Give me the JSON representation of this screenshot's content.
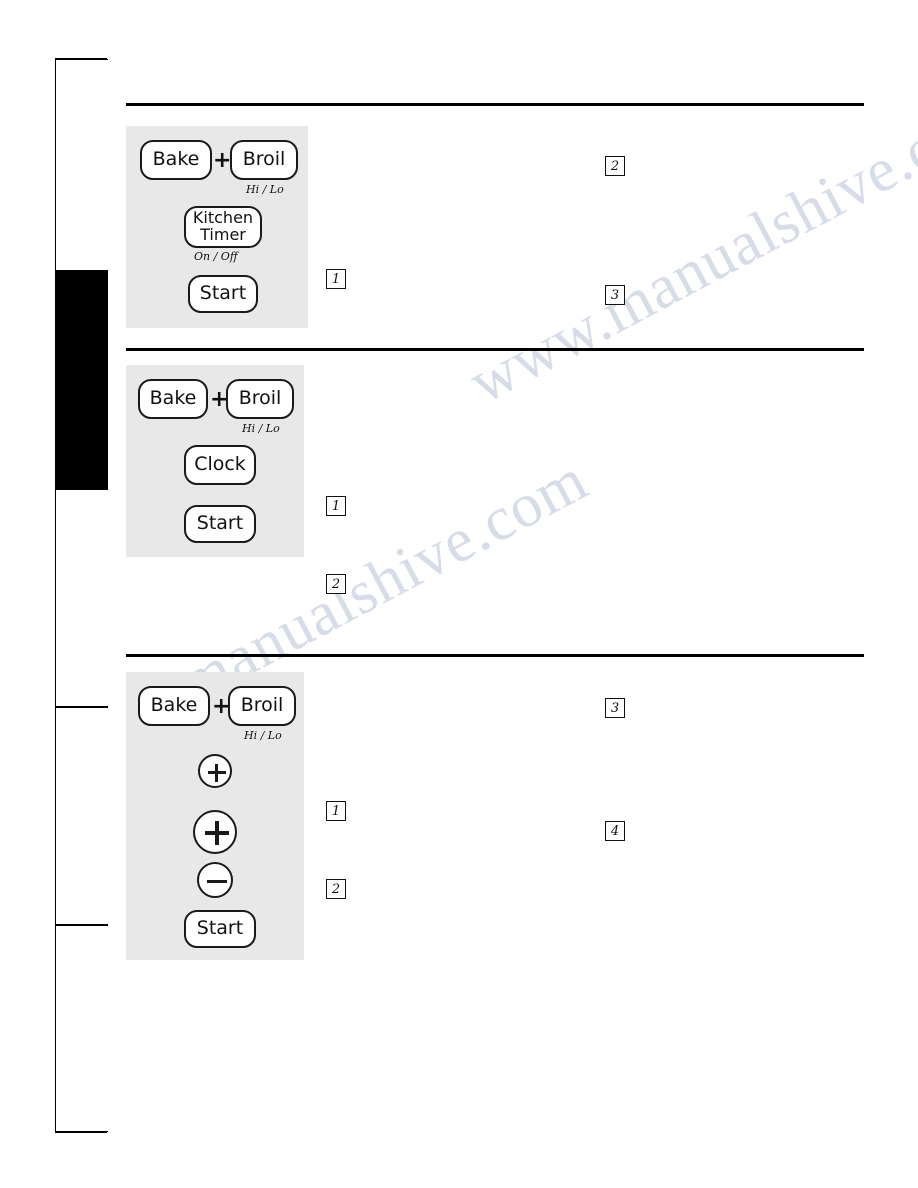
{
  "document": {
    "watermark_line1": "www.manualshive.com",
    "watermark_line2": "manualshive.com"
  },
  "tab_strip": {
    "name": "left-tab-strip",
    "segments": [
      {
        "label": "",
        "filled": false
      },
      {
        "label": "",
        "filled": true
      },
      {
        "label": "",
        "filled": false
      },
      {
        "label": "",
        "filled": false
      },
      {
        "label": "",
        "filled": false
      }
    ]
  },
  "sections": [
    {
      "id": "kitchen-timer",
      "panel": {
        "keys": [
          {
            "name": "bake-key",
            "lines": [
              "Bake"
            ]
          },
          {
            "name": "broil-key",
            "lines": [
              "Broil"
            ]
          },
          {
            "name": "kitchen-timer-key",
            "lines": [
              "Kitchen",
              "Timer"
            ]
          },
          {
            "name": "start-key",
            "lines": [
              "Start"
            ]
          }
        ],
        "plus_symbol": "+",
        "sublabels": [
          {
            "name": "broil-sublabel",
            "text": "Hi / Lo"
          },
          {
            "name": "kitchen-timer-sublabel",
            "text": "On / Off"
          }
        ]
      },
      "steps": [
        {
          "name": "step-marker-1",
          "number": "1"
        },
        {
          "name": "step-marker-2",
          "number": "2"
        },
        {
          "name": "step-marker-3",
          "number": "3"
        }
      ]
    },
    {
      "id": "clock",
      "panel": {
        "keys": [
          {
            "name": "bake-key",
            "lines": [
              "Bake"
            ]
          },
          {
            "name": "broil-key",
            "lines": [
              "Broil"
            ]
          },
          {
            "name": "clock-key",
            "lines": [
              "Clock"
            ]
          },
          {
            "name": "start-key",
            "lines": [
              "Start"
            ]
          }
        ],
        "plus_symbol": "+",
        "sublabels": [
          {
            "name": "broil-sublabel",
            "text": "Hi / Lo"
          }
        ]
      },
      "steps": [
        {
          "name": "step-marker-1",
          "number": "1"
        },
        {
          "name": "step-marker-2",
          "number": "2"
        }
      ]
    },
    {
      "id": "plus-minus",
      "panel": {
        "keys": [
          {
            "name": "bake-key",
            "lines": [
              "Bake"
            ]
          },
          {
            "name": "broil-key",
            "lines": [
              "Broil"
            ]
          },
          {
            "name": "start-key",
            "lines": [
              "Start"
            ]
          }
        ],
        "plus_symbol": "+",
        "round_keys": [
          {
            "name": "plus-key-small",
            "symbol": "+"
          },
          {
            "name": "plus-key-large",
            "symbol": "+"
          },
          {
            "name": "minus-key",
            "symbol": "−"
          }
        ],
        "sublabels": [
          {
            "name": "broil-sublabel",
            "text": "Hi / Lo"
          }
        ]
      },
      "steps": [
        {
          "name": "step-marker-1",
          "number": "1"
        },
        {
          "name": "step-marker-2",
          "number": "2"
        },
        {
          "name": "step-marker-3",
          "number": "3"
        },
        {
          "name": "step-marker-4",
          "number": "4"
        }
      ]
    }
  ],
  "colors": {
    "panel_bg": "#e8e8e8",
    "key_border": "#1a1a1a",
    "rule": "#000000",
    "watermark": "#cfd6e4"
  }
}
